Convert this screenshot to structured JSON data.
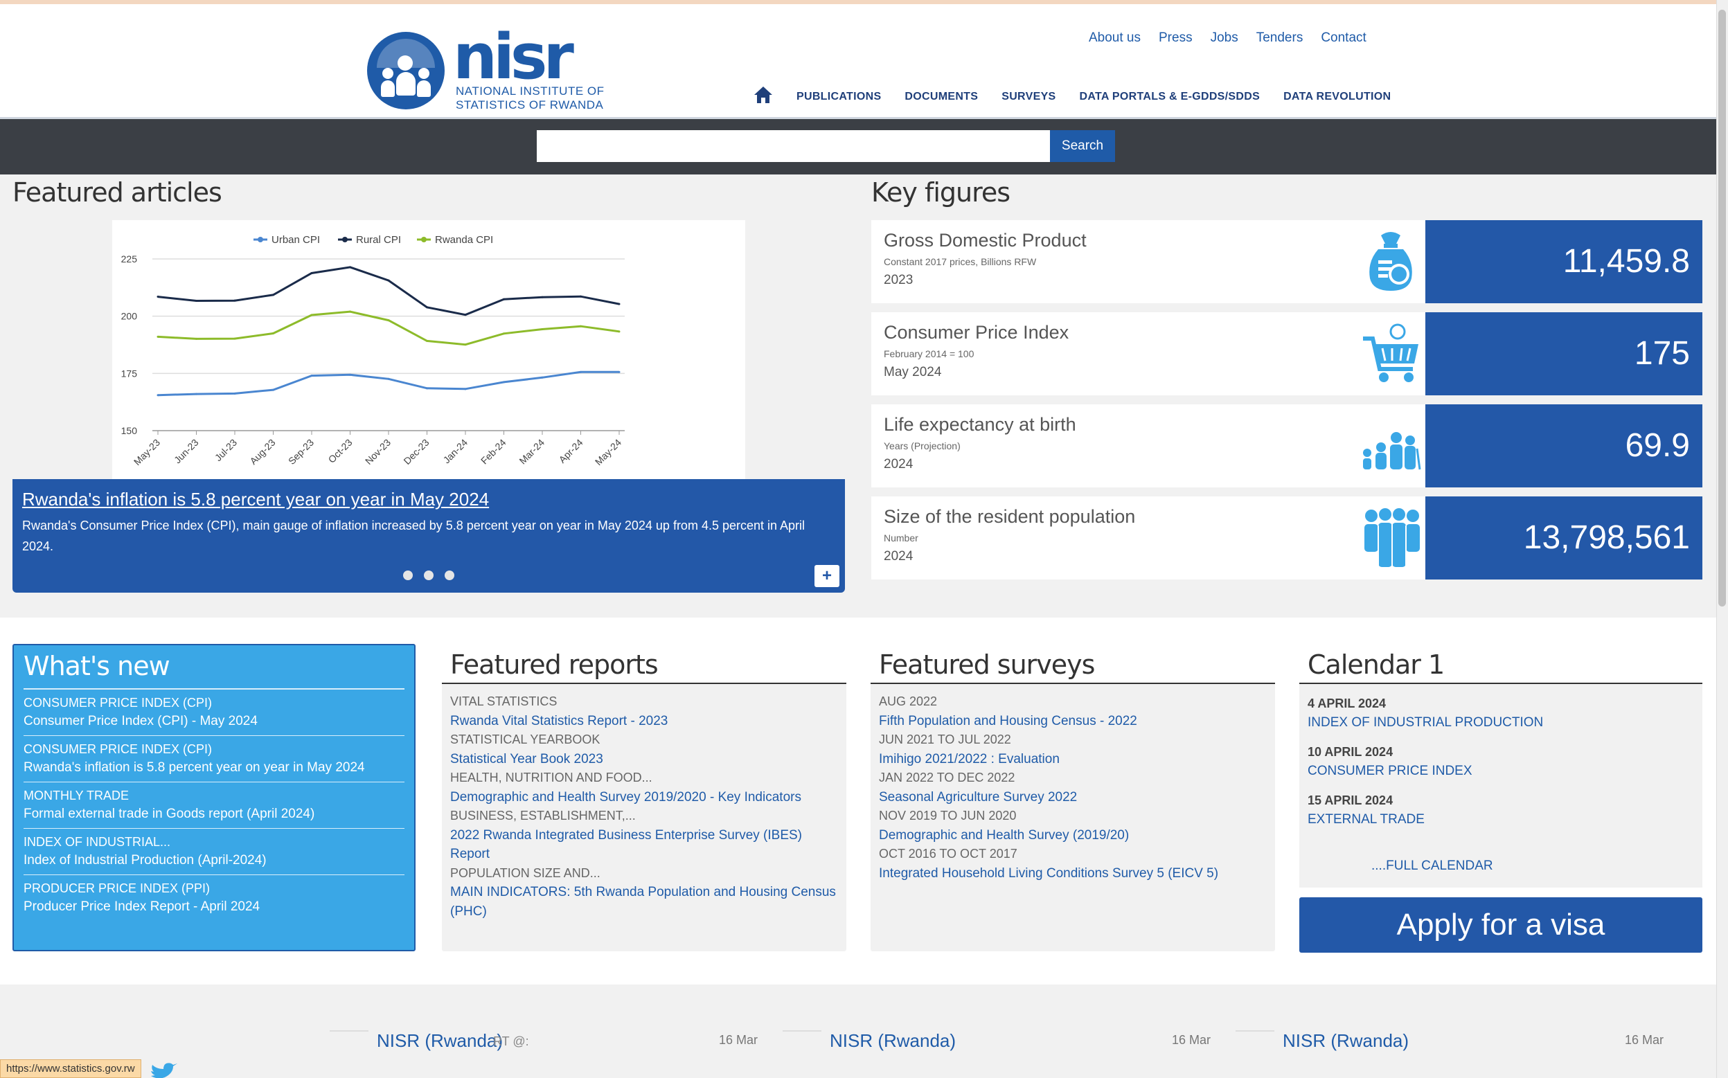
{
  "header": {
    "brand": "nisr",
    "tagline_line1": "NATIONAL INSTITUTE OF",
    "tagline_line2": "STATISTICS OF RWANDA",
    "top_links": [
      "About us",
      "Press",
      "Jobs",
      "Tenders",
      "Contact"
    ],
    "nav": [
      "PUBLICATIONS",
      "DOCUMENTS",
      "SURVEYS",
      "DATA PORTALS & E-GDDS/SDDS",
      "DATA REVOLUTION"
    ]
  },
  "search": {
    "value": "",
    "button": "Search"
  },
  "featured": {
    "title": "Featured articles",
    "slide_title": "Rwanda's inflation is 5.8 percent year on year in May 2024",
    "slide_text": "Rwanda's Consumer Price Index (CPI), main gauge of inflation increased by 5.8 percent year on year in May 2024 up from 4.5 percent in April 2024.",
    "more": "+"
  },
  "chart_data": {
    "type": "line",
    "categories": [
      "May-23",
      "Jun-23",
      "Jul-23",
      "Aug-23",
      "Sep-23",
      "Oct-23",
      "Nov-23",
      "Dec-23",
      "Jan-24",
      "Feb-24",
      "Mar-24",
      "Apr-24",
      "May-24"
    ],
    "series": [
      {
        "name": "Urban CPI",
        "color": "#4a86d0",
        "values": [
          165.5,
          166,
          166.2,
          167.8,
          174,
          174.4,
          172.6,
          168.5,
          168.2,
          171.2,
          173.2,
          175.6,
          175.6
        ]
      },
      {
        "name": "Rural CPI",
        "color": "#1a2b4a",
        "values": [
          208.5,
          206.7,
          206.8,
          209.3,
          218.8,
          221.4,
          215.6,
          203.9,
          200.6,
          207.4,
          208.3,
          208.6,
          205.3
        ]
      },
      {
        "name": "Rwanda CPI",
        "color": "#8dbb2a",
        "values": [
          191,
          190.1,
          190.2,
          192.5,
          200.5,
          202,
          198.2,
          189.2,
          187.6,
          192.4,
          194.3,
          195.6,
          193.3
        ]
      }
    ],
    "yticks": [
      150,
      175,
      200,
      225
    ],
    "ylim": [
      150,
      225
    ],
    "grid": true,
    "legend": "top"
  },
  "key_figures": {
    "title": "Key figures",
    "items": [
      {
        "name": "Gross Domestic Product",
        "sub": "Constant 2017 prices, Billions RFW",
        "year": "2023",
        "value": "11,459.8",
        "icon": "gdp-bag-icon"
      },
      {
        "name": "Consumer Price Index",
        "sub": "February 2014 = 100",
        "year": "May 2024",
        "value": "175",
        "icon": "cart-icon"
      },
      {
        "name": "Life expectancy at birth",
        "sub": "Years (Projection)",
        "year": "2024",
        "value": "69.9",
        "icon": "family-icon"
      },
      {
        "name": "Size of the resident population",
        "sub": "Number",
        "year": "2024",
        "value": "13,798,561",
        "icon": "population-icon"
      }
    ]
  },
  "whats_new": {
    "title": "What's new",
    "items": [
      {
        "cat": "CONSUMER PRICE INDEX (CPI)",
        "link": "Consumer Price Index (CPI) - May 2024"
      },
      {
        "cat": "CONSUMER PRICE INDEX (CPI)",
        "link": "Rwanda's inflation is 5.8 percent year on year in May 2024"
      },
      {
        "cat": "MONTHLY TRADE",
        "link": "Formal external trade in Goods report (April 2024)"
      },
      {
        "cat": "INDEX OF INDUSTRIAL...",
        "link": "Index of Industrial Production (April-2024)"
      },
      {
        "cat": "PRODUCER PRICE INDEX (PPI)",
        "link": "Producer Price Index Report - April 2024"
      }
    ]
  },
  "featured_reports": {
    "title": "Featured reports",
    "items": [
      {
        "cat": "VITAL STATISTICS",
        "link": "Rwanda Vital Statistics Report - 2023"
      },
      {
        "cat": "STATISTICAL YEARBOOK",
        "link": "Statistical Year Book 2023"
      },
      {
        "cat": "HEALTH, NUTRITION AND FOOD...",
        "link": "Demographic and Health Survey 2019/2020 - Key Indicators"
      },
      {
        "cat": "BUSINESS, ESTABLISHMENT,...",
        "link": "2022 Rwanda Integrated Business Enterprise Survey (IBES) Report"
      },
      {
        "cat": "POPULATION SIZE AND...",
        "link": "MAIN INDICATORS: 5th Rwanda Population and Housing Census (PHC)"
      }
    ]
  },
  "featured_surveys": {
    "title": "Featured surveys",
    "items": [
      {
        "cat": "AUG 2022",
        "link": "Fifth Population and Housing Census - 2022"
      },
      {
        "cat": "JUN 2021 TO JUL 2022",
        "link": "Imihigo 2021/2022 : Evaluation"
      },
      {
        "cat": "JAN 2022 TO DEC 2022",
        "link": "Seasonal Agriculture Survey 2022"
      },
      {
        "cat": "NOV 2019 TO JUN 2020",
        "link": "Demographic and Health Survey (2019/20)"
      },
      {
        "cat": "OCT 2016 TO OCT 2017",
        "link": "Integrated Household Living Conditions Survey 5 (EICV 5)"
      }
    ]
  },
  "calendar": {
    "title": "Calendar 1",
    "events": [
      {
        "date": "4 APRIL 2024",
        "link": "INDEX OF INDUSTRIAL PRODUCTION"
      },
      {
        "date": "10 APRIL 2024",
        "link": "CONSUMER PRICE INDEX"
      },
      {
        "date": "15 APRIL 2024",
        "link": "EXTERNAL TRADE"
      }
    ],
    "full": "....FULL CALENDAR"
  },
  "visa": "Apply for a visa",
  "tweets": [
    {
      "name": "NISR (Rwanda)",
      "rt": "RT @:",
      "date": "16 Mar"
    },
    {
      "name": "NISR (Rwanda)",
      "rt": "",
      "date": "16 Mar"
    },
    {
      "name": "NISR (Rwanda)",
      "rt": "",
      "date": "16 Mar"
    }
  ],
  "status_url": "https://www.statistics.gov.rw"
}
